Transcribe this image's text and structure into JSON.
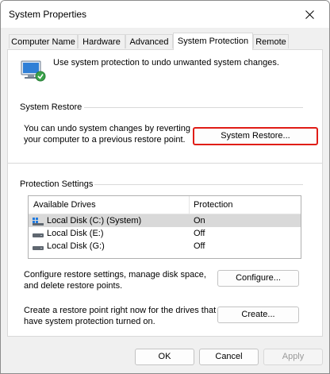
{
  "window": {
    "title": "System Properties"
  },
  "tabs": [
    {
      "label": "Computer Name"
    },
    {
      "label": "Hardware"
    },
    {
      "label": "Advanced"
    },
    {
      "label": "System Protection"
    },
    {
      "label": "Remote"
    }
  ],
  "active_tab": "System Protection",
  "intro": {
    "text": "Use system protection to undo unwanted system changes."
  },
  "system_restore": {
    "heading": "System Restore",
    "line1": "You can undo system changes by reverting",
    "line2": "your computer to a previous restore point.",
    "button_label": "System Restore..."
  },
  "protection_settings": {
    "heading": "Protection Settings",
    "columns": [
      "Available Drives",
      "Protection"
    ],
    "drives": [
      {
        "name": "Local Disk (C:) (System)",
        "protection": "On",
        "icon": "system-drive-icon",
        "selected": true
      },
      {
        "name": "Local Disk (E:)",
        "protection": "Off",
        "icon": "drive-icon",
        "selected": false
      },
      {
        "name": "Local Disk (G:)",
        "protection": "Off",
        "icon": "drive-icon",
        "selected": false
      }
    ]
  },
  "configure": {
    "line1": "Configure restore settings, manage disk space,",
    "line2": "and delete restore points.",
    "button_label": "Configure..."
  },
  "create": {
    "line1": "Create a restore point right now for the drives that",
    "line2": "have system protection turned on.",
    "button_label": "Create..."
  },
  "footer": {
    "ok_label": "OK",
    "cancel_label": "Cancel",
    "apply_label": "Apply"
  },
  "colors": {
    "highlight_border": "#e01d17",
    "selected_row": "#d9d9d9"
  }
}
